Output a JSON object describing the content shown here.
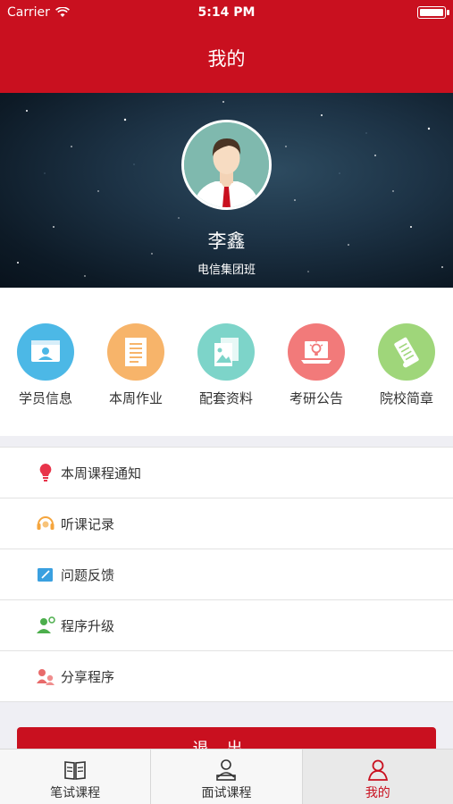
{
  "status_bar": {
    "carrier": "Carrier",
    "time": "5:14 PM"
  },
  "header": {
    "title": "我的"
  },
  "profile": {
    "name": "李鑫",
    "class_name": "电信集团班"
  },
  "quick_links": [
    {
      "label": "学员信息",
      "color": "#4cb8e6",
      "icon": "student-info-icon"
    },
    {
      "label": "本周作业",
      "color": "#f7b46a",
      "icon": "homework-icon"
    },
    {
      "label": "配套资料",
      "color": "#7dd4c9",
      "icon": "materials-icon"
    },
    {
      "label": "考研公告",
      "color": "#f27a7a",
      "icon": "announcement-icon"
    },
    {
      "label": "院校简章",
      "color": "#9fd67a",
      "icon": "brochure-icon"
    }
  ],
  "menu": [
    {
      "label": "本周课程通知",
      "icon": "bulb-icon"
    },
    {
      "label": "听课记录",
      "icon": "headset-icon"
    },
    {
      "label": "问题反馈",
      "icon": "edit-icon"
    },
    {
      "label": "程序升级",
      "icon": "upgrade-icon"
    },
    {
      "label": "分享程序",
      "icon": "share-icon"
    }
  ],
  "logout_label": "退出",
  "tabs": [
    {
      "label": "笔试课程",
      "icon": "book-icon"
    },
    {
      "label": "面试课程",
      "icon": "interview-icon"
    },
    {
      "label": "我的",
      "icon": "person-icon",
      "active": true
    }
  ],
  "colors": {
    "brand": "#c9101f"
  }
}
